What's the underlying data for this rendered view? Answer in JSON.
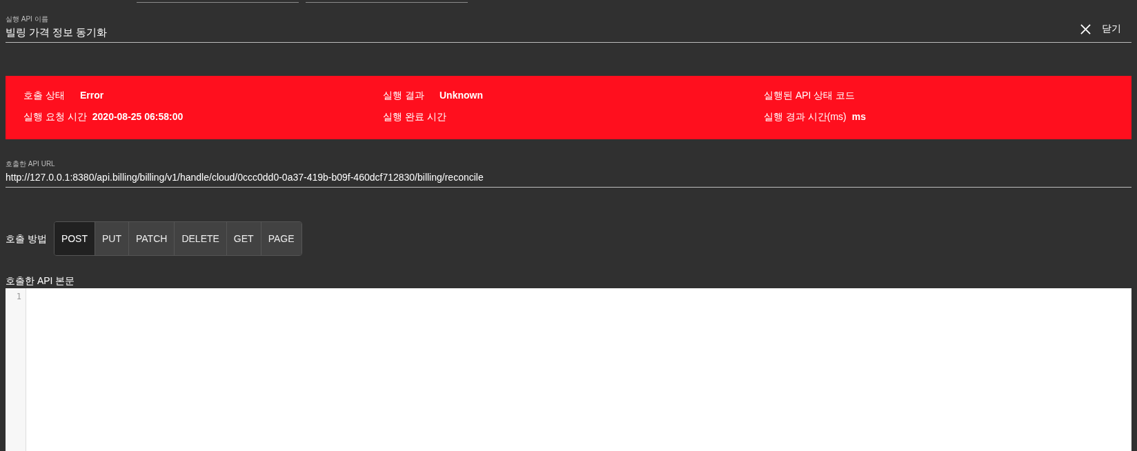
{
  "api_name_field": {
    "label": "실행 API 이름",
    "value": "빌링 가격 정보 동기화"
  },
  "close_button": {
    "label": "닫기"
  },
  "status_panel": {
    "kind": "error",
    "items": [
      {
        "label": "호출 상태",
        "value": "Error"
      },
      {
        "label": "실행 결과",
        "value": "Unknown"
      },
      {
        "label": "실행된 API 상태 코드"
      },
      {
        "label": "실행 요청 시간",
        "value": "2020-08-25 06:58:00"
      },
      {
        "label": "실행 완료 시간"
      },
      {
        "label": "실행 경과 시간(ms)",
        "value": "ms"
      }
    ]
  },
  "url_field": {
    "label": "호출한 API URL",
    "value": "http://127.0.0.1:8380/api.billing/billing/v1/handle/cloud/0ccc0dd0-0a37-419b-b09f-460dcf712830/billing/reconcile"
  },
  "method": {
    "label": "호출 방법",
    "options": [
      {
        "label": "POST",
        "selected": true
      },
      {
        "label": "PUT",
        "selected": false
      },
      {
        "label": "PATCH",
        "selected": false
      },
      {
        "label": "DELETE",
        "selected": false
      },
      {
        "label": "GET",
        "selected": false
      },
      {
        "label": "PAGE",
        "selected": false
      }
    ]
  },
  "body_editor": {
    "label": "호출한 API 본문",
    "line_numbers": [
      "1"
    ]
  }
}
